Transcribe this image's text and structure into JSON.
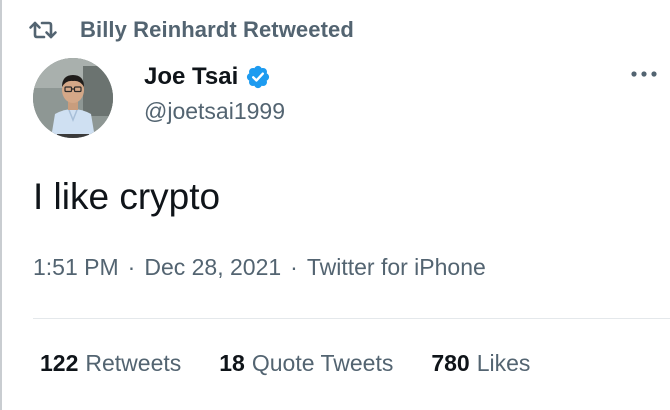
{
  "retweet_header": {
    "icon": "retweet-icon",
    "text": "Billy Reinhardt Retweeted"
  },
  "author": {
    "display_name": "Joe Tsai",
    "handle": "@joetsai1999",
    "verified": true,
    "verified_icon": "verified-badge-icon",
    "badge_color": "#1d9bf0"
  },
  "more_icon": "more-horizontal-icon",
  "tweet": {
    "text": "I like crypto",
    "time": "1:51 PM",
    "separator_1": "·",
    "date": "Dec 28, 2021",
    "separator_2": "·",
    "source": "Twitter for iPhone"
  },
  "stats": {
    "retweets": {
      "count": "122",
      "label": "Retweets"
    },
    "quote_tweets": {
      "count": "18",
      "label": "Quote Tweets"
    },
    "likes": {
      "count": "780",
      "label": "Likes"
    }
  },
  "colors": {
    "primary_text": "#0f1419",
    "secondary_text": "#536471",
    "accent": "#1d9bf0",
    "divider": "#e4e8eb"
  }
}
